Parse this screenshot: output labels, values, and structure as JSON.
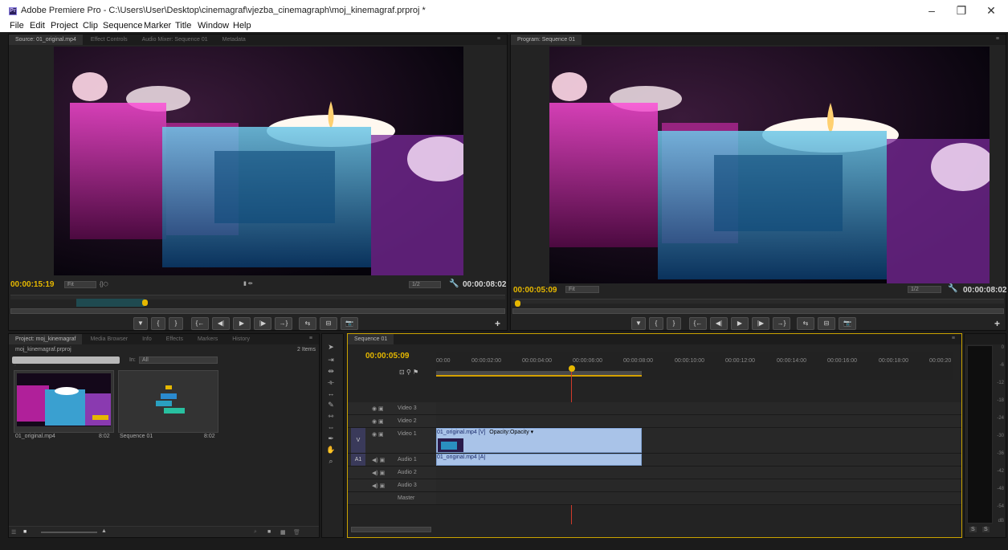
{
  "window": {
    "app_icon": "Pr",
    "title": "Adobe Premiere Pro - C:\\Users\\User\\Desktop\\cinemagraf\\vjezba_cinemagraph\\moj_kinemagraf.prproj *",
    "minimize": "–",
    "maximize": "❐",
    "close": "✕"
  },
  "menu": [
    "File",
    "Edit",
    "Project",
    "Clip",
    "Sequence",
    "Marker",
    "Title",
    "Window",
    "Help"
  ],
  "source_panel": {
    "tabs": [
      "Source: 01_original.mp4",
      "Effect Controls",
      "Audio Mixer: Sequence 01",
      "Metadata"
    ],
    "current_time": "00:00:15:19",
    "zoom": "Fit",
    "resolution": "1/2",
    "duration": "00:00:08:02"
  },
  "program_panel": {
    "tab": "Program: Sequence 01",
    "current_time": "00:00:05:09",
    "zoom": "Fit",
    "resolution": "1/2",
    "duration": "00:00:08:02"
  },
  "transport_glyphs": [
    "▼",
    "{",
    "}",
    "{←",
    "◀|",
    "▶",
    "|▶",
    "→}",
    "⇆",
    "⊟",
    "📷"
  ],
  "project_panel": {
    "tabs": [
      "Project: moj_kinemagraf",
      "Media Browser",
      "Info",
      "Effects",
      "Markers",
      "History"
    ],
    "project_file": "moj_kinemagraf.prproj",
    "item_count": "2 Items",
    "in_label": "In:",
    "in_value": "All",
    "items": [
      {
        "name": "01_original.mp4",
        "duration": "8:02"
      },
      {
        "name": "Sequence 01",
        "duration": "8:02"
      }
    ]
  },
  "timeline": {
    "tab": "Sequence 01",
    "current_time": "00:00:05:09",
    "ruler": [
      "00:00",
      "00:00:02:00",
      "00:00:04:00",
      "00:00:06:00",
      "00:00:08:00",
      "00:00:10:00",
      "00:00:12:00",
      "00:00:14:00",
      "00:00:16:00",
      "00:00:18:00",
      "00:00:20"
    ],
    "tracks": [
      {
        "name": "Video 3",
        "kind": "video"
      },
      {
        "name": "Video 2",
        "kind": "video"
      },
      {
        "name": "Video 1",
        "kind": "video",
        "label": "V"
      },
      {
        "name": "Audio 1",
        "kind": "audio",
        "label": "A1"
      },
      {
        "name": "Audio 2",
        "kind": "audio"
      },
      {
        "name": "Audio 3",
        "kind": "audio"
      },
      {
        "name": "Master",
        "kind": "master"
      }
    ],
    "video_clip": "01_original.mp4 [V]",
    "video_clip_fx": "Opacity:Opacity ▾",
    "audio_clip": "01_original.mp4 [A]"
  },
  "meter_scale": [
    "0",
    "-6",
    "-12",
    "-18",
    "-24",
    "-30",
    "-36",
    "-42",
    "-48",
    "-54",
    "dB"
  ],
  "meter_solo": [
    "S",
    "S"
  ]
}
